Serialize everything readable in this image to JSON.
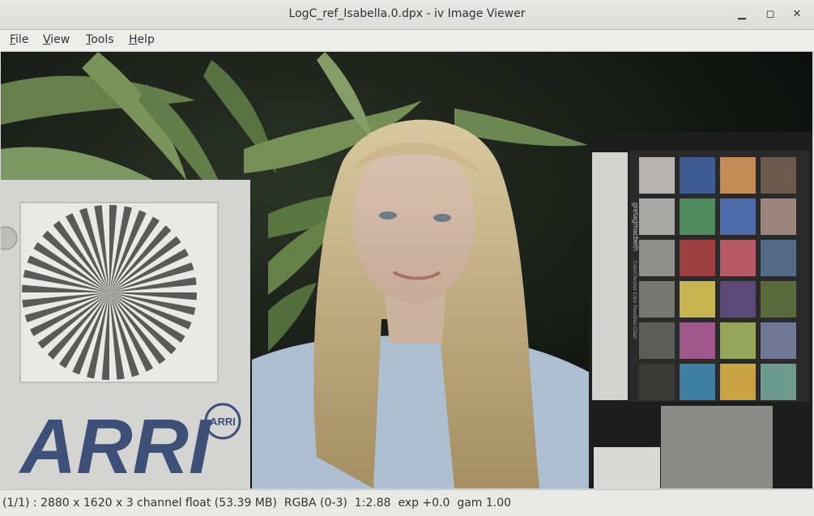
{
  "window": {
    "title": "LogC_ref_Isabella.0.dpx - iv Image Viewer",
    "controls": [
      "minimize-icon",
      "maximize-icon",
      "close-icon"
    ]
  },
  "menubar": {
    "items": [
      {
        "label": "File",
        "mnemonic": "F"
      },
      {
        "label": "View",
        "mnemonic": "V"
      },
      {
        "label": "Tools",
        "mnemonic": "T"
      },
      {
        "label": "Help",
        "mnemonic": "H"
      }
    ]
  },
  "image": {
    "logo_text": "ARRI",
    "seal_text": "ARRI",
    "chart_vertical_text": "gretagmacbeth",
    "chart_vertical_text2": "ColorChecker Color Rendition Chart",
    "checker_colors": [
      "#b6b4b2",
      "#3e5b93",
      "#c28b58",
      "#6d5a4f",
      "#a8a8a6",
      "#4f8a5d",
      "#4e6aa8",
      "#9c857f",
      "#8f8f8d",
      "#9b3e40",
      "#b55a66",
      "#536b86",
      "#777775",
      "#c8b552",
      "#5b4a78",
      "#5b6a3c",
      "#5c5c5a",
      "#9d5789",
      "#97a45c",
      "#6f7794",
      "#3b3b3a",
      "#3f7fa1",
      "#c9a243",
      "#6f9a8e"
    ]
  },
  "status": {
    "text": "(1/1) : 2880 x 1620 x 3 channel float (53.39 MB)  RGBA (0-3)  1:2.88  exp +0.0  gam 1.00"
  }
}
